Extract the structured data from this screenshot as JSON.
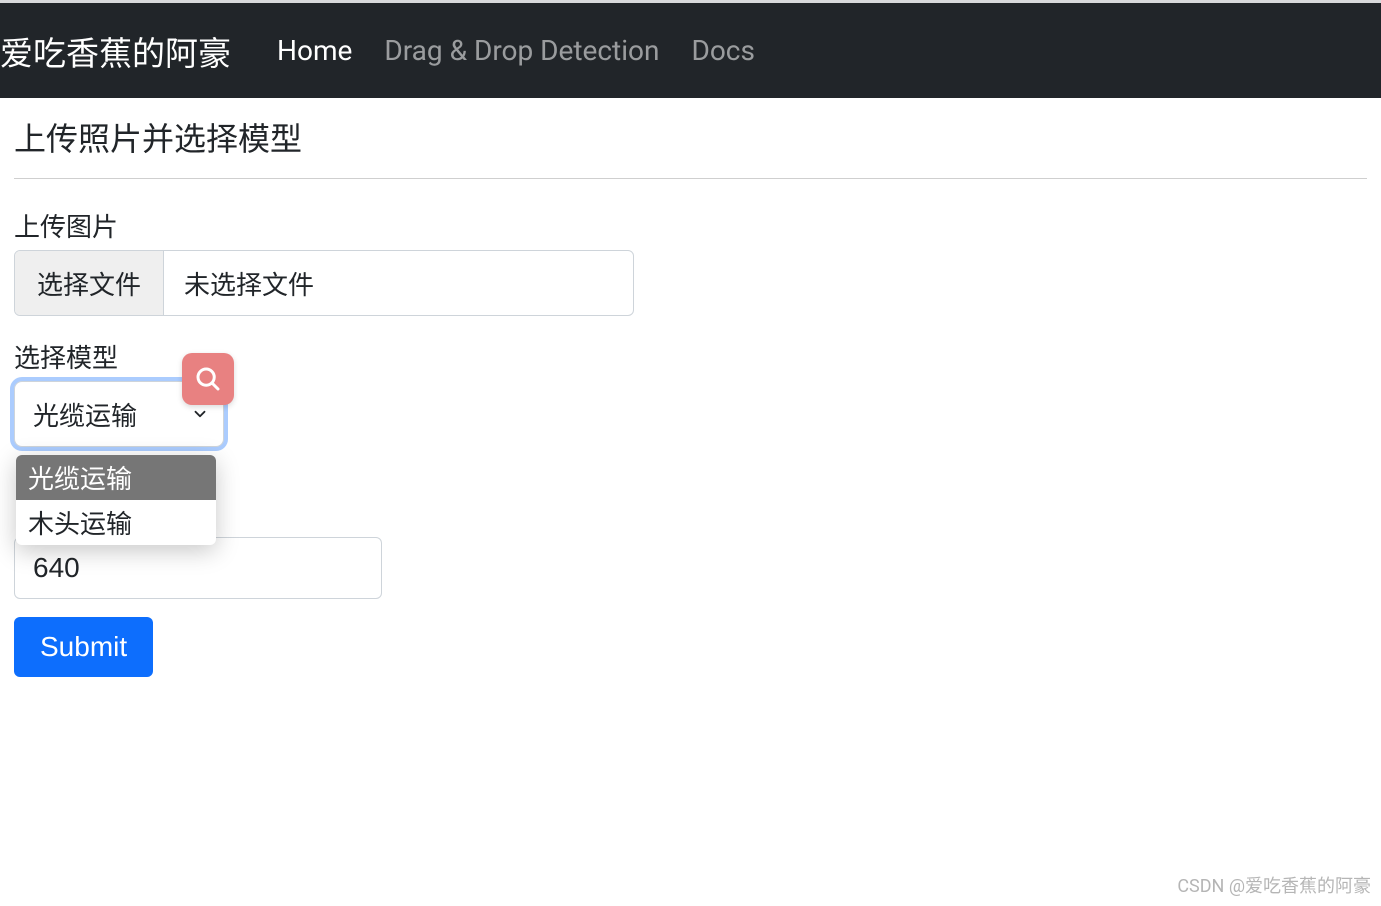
{
  "navbar": {
    "brand": "爱吃香蕉的阿豪",
    "links": [
      {
        "label": "Home",
        "active": true
      },
      {
        "label": "Drag & Drop Detection",
        "active": false
      },
      {
        "label": "Docs",
        "active": false
      }
    ]
  },
  "page": {
    "title": "上传照片并选择模型"
  },
  "upload": {
    "label": "上传图片",
    "choose_button": "选择文件",
    "status": "未选择文件"
  },
  "model_select": {
    "label": "选择模型",
    "selected": "光缆运输",
    "options": [
      "光缆运输",
      "木头运输"
    ]
  },
  "size_input": {
    "value": "640"
  },
  "submit": {
    "label": "Submit"
  },
  "watermark": "CSDN @爱吃香蕉的阿豪"
}
